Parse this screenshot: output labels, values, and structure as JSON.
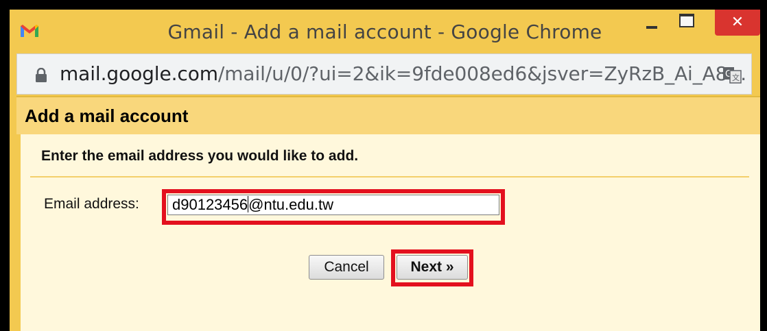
{
  "window": {
    "title": "Gmail - Add a mail account - Google Chrome",
    "minimize_icon": "minimize-icon",
    "maximize_icon": "maximize-icon",
    "close_symbol": "✕"
  },
  "address_bar": {
    "url_host": "mail.google.com",
    "url_path": "/mail/u/0/?ui=2&ik=9fde008ed6&jsver=ZyRzB_Ai_A8…",
    "lock_icon": "lock-icon",
    "translate_icon": "translate-icon"
  },
  "dialog": {
    "title": "Add a mail account",
    "instruction": "Enter the email address you would like to add.",
    "email_label": "Email address:",
    "email_value_before_caret": "d90123456",
    "email_value_after_caret": "@ntu.edu.tw",
    "cancel_label": "Cancel",
    "next_label": "Next »"
  },
  "colors": {
    "frame_yellow": "#f3c950",
    "header_yellow": "#f9d77c",
    "body_cream": "#fff8dc",
    "highlight_red": "#e3101e",
    "close_red": "#d9342f"
  }
}
